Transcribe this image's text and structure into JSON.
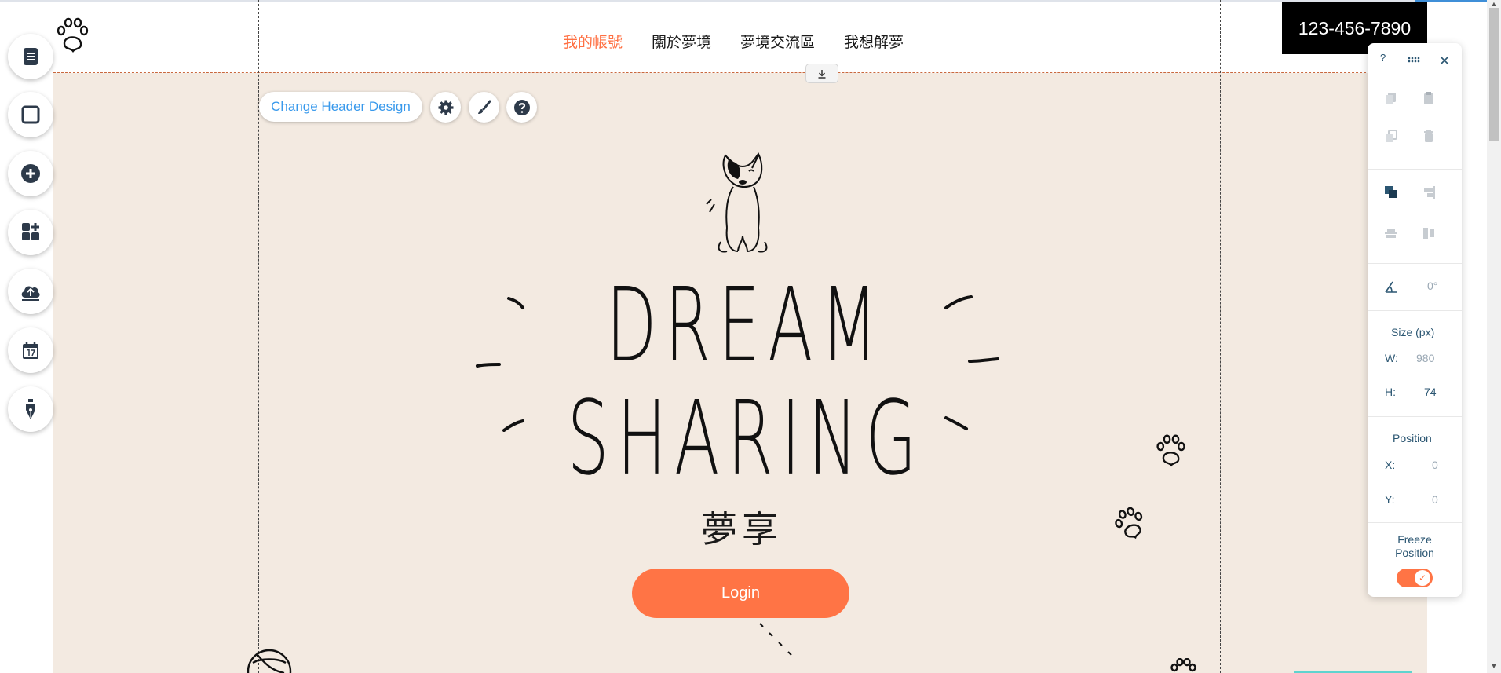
{
  "header": {
    "menu": [
      {
        "label": "我的帳號",
        "active": true
      },
      {
        "label": "關於夢境",
        "active": false
      },
      {
        "label": "夢境交流區",
        "active": false
      },
      {
        "label": "我想解夢",
        "active": false
      }
    ],
    "phone": "123-456-7890",
    "change_design_label": "Change Header Design"
  },
  "hero": {
    "title_line1": "DREAM",
    "title_line2": "SHARING",
    "subtitle": "夢享",
    "login_label": "Login"
  },
  "left_toolbar": [
    {
      "icon": "pages-icon"
    },
    {
      "icon": "background-icon"
    },
    {
      "icon": "add-icon"
    },
    {
      "icon": "app-market-icon"
    },
    {
      "icon": "upload-icon"
    },
    {
      "icon": "calendar-icon"
    },
    {
      "icon": "blog-pen-icon"
    }
  ],
  "panel": {
    "help": "?",
    "rotation": "0°",
    "size_title": "Size (px)",
    "w_label": "W:",
    "w_value": "980",
    "h_label": "H:",
    "h_value": "74",
    "position_title": "Position",
    "x_label": "X:",
    "x_value": "0",
    "y_label": "Y:",
    "y_value": "0",
    "freeze_label": "Freeze Position",
    "freeze_on": true
  },
  "colors": {
    "accent_orange": "#ff7445",
    "canvas_bg": "#f3eae1",
    "editor_blue": "#3899ec",
    "panel_text": "#2b5672"
  }
}
